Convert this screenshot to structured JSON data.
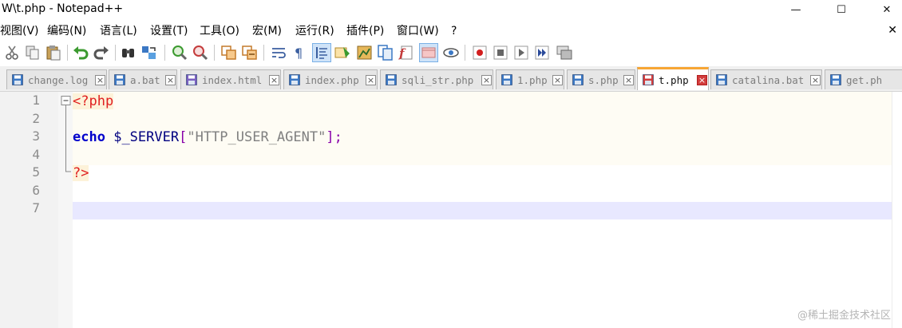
{
  "window": {
    "title": "W\\t.php - Notepad++",
    "minimize": "—",
    "maximize": "☐",
    "close": "✕"
  },
  "menu": {
    "items": [
      "视图(V)",
      "编码(N)",
      "语言(L)",
      "设置(T)",
      "工具(O)",
      "宏(M)",
      "运行(R)",
      "插件(P)",
      "窗口(W)",
      "?"
    ],
    "close": "✕"
  },
  "toolbar": {
    "icons": [
      "cut-icon",
      "copy-icon",
      "paste-icon",
      "undo-icon",
      "redo-icon",
      "find-icon",
      "replace-icon",
      "zoom-in-icon",
      "zoom-out-icon",
      "sync-vertical-icon",
      "sync-horizontal-icon",
      "word-wrap-icon",
      "show-all-chars-icon",
      "indent-guide-icon",
      "user-defined-lang-icon",
      "document-map-icon",
      "document-list-icon",
      "function-list-icon",
      "folder-workspace-icon",
      "monitoring-icon",
      "record-macro-icon",
      "stop-record-icon",
      "playback-macro-icon",
      "run-macro-multiple-icon",
      "save-macro-icon"
    ]
  },
  "tabs": [
    {
      "label": "change.log",
      "active": false,
      "icon_color": "#3b78c4"
    },
    {
      "label": "a.bat",
      "active": false,
      "icon_color": "#3b78c4"
    },
    {
      "label": "index.html",
      "active": false,
      "icon_color": "#7a5fc0"
    },
    {
      "label": "index.php",
      "active": false,
      "icon_color": "#3b78c4"
    },
    {
      "label": "sqli_str.php",
      "active": false,
      "icon_color": "#3b78c4"
    },
    {
      "label": "1.php",
      "active": false,
      "icon_color": "#3b78c4"
    },
    {
      "label": "s.php",
      "active": false,
      "icon_color": "#3b78c4"
    },
    {
      "label": "t.php",
      "active": true,
      "icon_color": "#d23c3c"
    },
    {
      "label": "catalina.bat",
      "active": false,
      "icon_color": "#3b78c4"
    },
    {
      "label": "get.ph",
      "active": false,
      "icon_color": "#3b78c4"
    }
  ],
  "editor": {
    "line_numbers": [
      "1",
      "2",
      "3",
      "4",
      "5",
      "6",
      "7"
    ],
    "lines": {
      "l1": "<?php",
      "l3_kw": "echo",
      "l3_var": "$_SERVER",
      "l3_open": "[",
      "l3_str": "\"HTTP_USER_AGENT\"",
      "l3_close": "];",
      "l5": "?>"
    },
    "current_line": 7
  },
  "watermark": "@稀土掘金技术社区",
  "colors": {
    "active_tab_accent": "#f7a634",
    "keyword": "#0000cc",
    "php_tag": "#e02020",
    "string": "#808080"
  }
}
